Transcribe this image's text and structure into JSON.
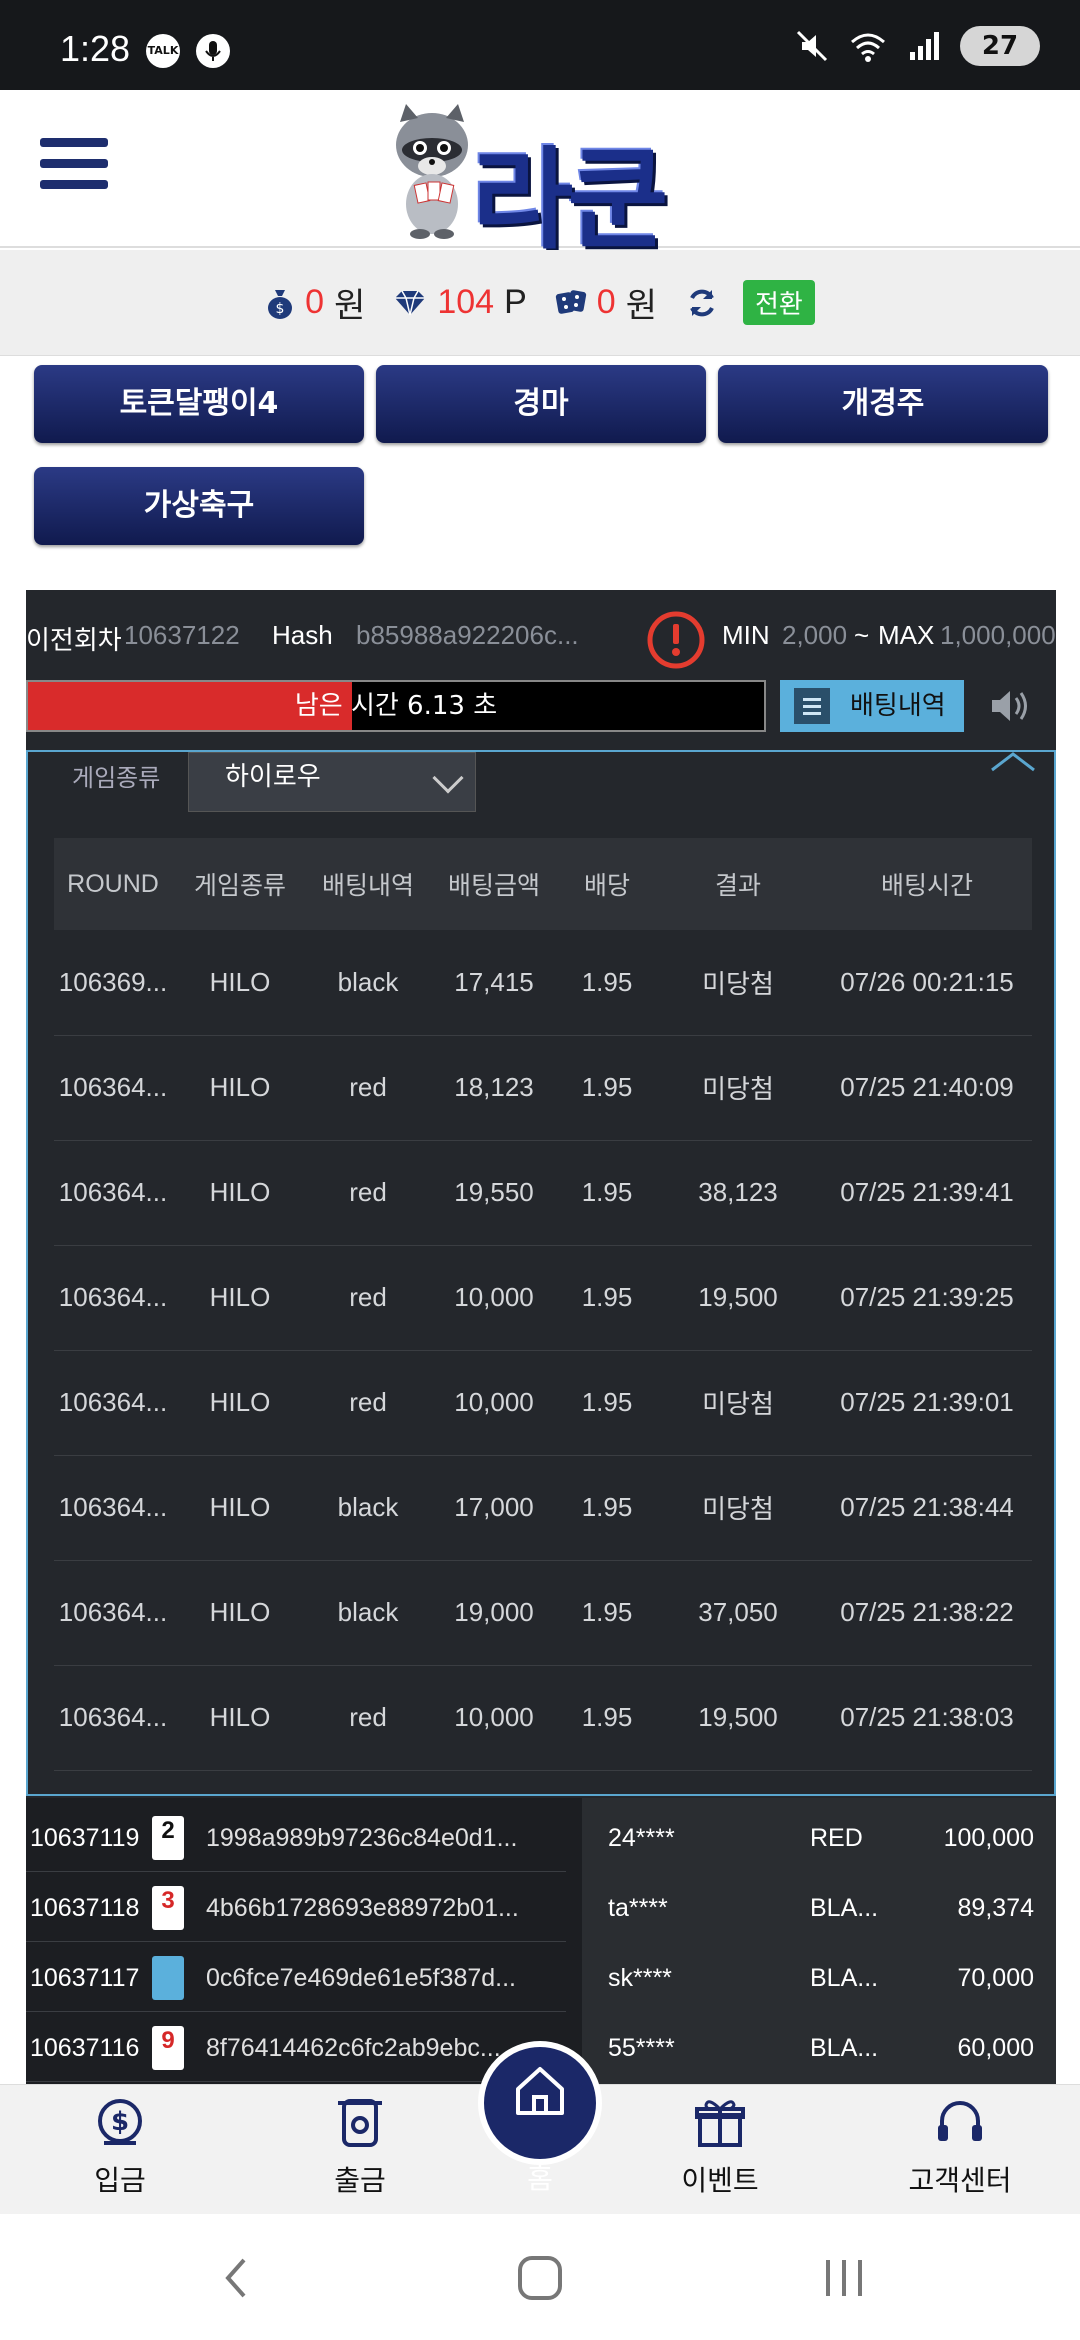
{
  "status_bar": {
    "time": "1:28",
    "talk_badge": "TALK",
    "battery": "27"
  },
  "header": {
    "logo_text": "라쿤"
  },
  "balance": {
    "money": "0",
    "money_unit": "원",
    "points": "104",
    "points_unit": "P",
    "casino": "0",
    "casino_unit": "원",
    "convert_label": "전환"
  },
  "games": [
    "토큰달팽이4",
    "경마",
    "개경주",
    "가상축구"
  ],
  "game_info": {
    "prev_round_label": "이전회차",
    "prev_round": "10637122",
    "hash_label": "Hash",
    "hash": "b85988a922206c...",
    "min_label": "MIN",
    "min": "2,000",
    "tilde": "~",
    "max_label": "MAX",
    "max": "1,000,000"
  },
  "timer": {
    "text": "남은 시간 6.13 초",
    "fill_fraction": 0.44
  },
  "history_button": "배팅내역",
  "filter": {
    "label": "게임종류",
    "selected": "하이로우"
  },
  "history_table": {
    "headers": [
      "ROUND",
      "게임종류",
      "배팅내역",
      "배팅금액",
      "배당",
      "결과",
      "배팅시간"
    ],
    "rows": [
      {
        "round": "106369...",
        "game": "HILO",
        "bet": "black",
        "amount": "17,415",
        "odds": "1.95",
        "result": "미당첨",
        "win": false,
        "time": "07/26 00:21:15"
      },
      {
        "round": "106364...",
        "game": "HILO",
        "bet": "red",
        "amount": "18,123",
        "odds": "1.95",
        "result": "미당첨",
        "win": false,
        "time": "07/25 21:40:09"
      },
      {
        "round": "106364...",
        "game": "HILO",
        "bet": "red",
        "amount": "19,550",
        "odds": "1.95",
        "result": "38,123",
        "win": true,
        "time": "07/25 21:39:41"
      },
      {
        "round": "106364...",
        "game": "HILO",
        "bet": "red",
        "amount": "10,000",
        "odds": "1.95",
        "result": "19,500",
        "win": true,
        "time": "07/25 21:39:25"
      },
      {
        "round": "106364...",
        "game": "HILO",
        "bet": "red",
        "amount": "10,000",
        "odds": "1.95",
        "result": "미당첨",
        "win": false,
        "time": "07/25 21:39:01"
      },
      {
        "round": "106364...",
        "game": "HILO",
        "bet": "black",
        "amount": "17,000",
        "odds": "1.95",
        "result": "미당첨",
        "win": false,
        "time": "07/25 21:38:44"
      },
      {
        "round": "106364...",
        "game": "HILO",
        "bet": "black",
        "amount": "19,000",
        "odds": "1.95",
        "result": "37,050",
        "win": true,
        "time": "07/25 21:38:22"
      },
      {
        "round": "106364...",
        "game": "HILO",
        "bet": "red",
        "amount": "10,000",
        "odds": "1.95",
        "result": "19,500",
        "win": true,
        "time": "07/25 21:38:03"
      }
    ]
  },
  "round_results": [
    {
      "round": "10637119",
      "card": "2",
      "card_color": "#111111",
      "hash": "1998a989b97236c84e0d1..."
    },
    {
      "round": "10637118",
      "card": "3",
      "card_color": "#d62828",
      "hash": "4b66b1728693e88972b01..."
    },
    {
      "round": "10637117",
      "card": "",
      "card_color": "#5bb0dc",
      "hash": "0c6fce7e469de61e5f387d..."
    },
    {
      "round": "10637116",
      "card": "9",
      "card_color": "#d62828",
      "hash": "8f76414462c6fc2ab9ebc..."
    }
  ],
  "live_bets": [
    {
      "user": "24****",
      "choice": "RED",
      "amount": "100,000"
    },
    {
      "user": "ta****",
      "choice": "BLA...",
      "amount": "89,374"
    },
    {
      "user": "sk****",
      "choice": "BLA...",
      "amount": "70,000"
    },
    {
      "user": "55****",
      "choice": "BLA...",
      "amount": "60,000"
    }
  ],
  "bottom_nav": {
    "deposit": "입금",
    "withdraw": "출금",
    "home": "홈",
    "event": "이벤트",
    "support": "고객센터"
  },
  "colors": {
    "brand_navy": "#1b2868",
    "lose": "#d23b3b",
    "win": "#8cc63f",
    "accent_blue": "#5bb0dc"
  }
}
